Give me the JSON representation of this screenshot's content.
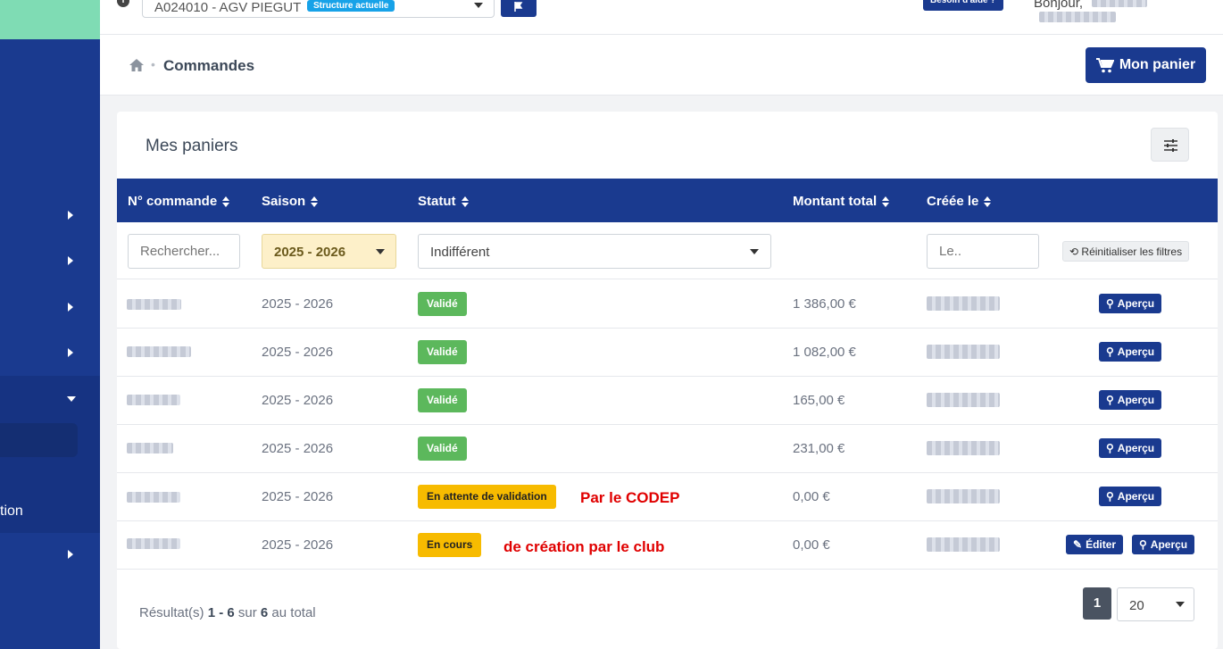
{
  "topbar": {
    "structure": "A024010 - AGV PIEGUT",
    "structure_badge": "Structure actuelle",
    "help": "Besoin d'aide ?",
    "greeting": "Bonjour,"
  },
  "breadcrumb": {
    "title": "Commandes"
  },
  "cart_button": "Mon panier",
  "sidebar": {
    "partial_label": "tion"
  },
  "card": {
    "title": "Mes paniers"
  },
  "table": {
    "headers": [
      "N° commande",
      "Saison",
      "Statut",
      "Montant total",
      "Créée le"
    ],
    "filters": {
      "search_placeholder": "Rechercher...",
      "season": "2025 - 2026",
      "status": "Indifférent",
      "date_placeholder": "Le..",
      "reset": "Réinitialiser les filtres"
    },
    "rows": [
      {
        "season": "2025 - 2026",
        "status": "Validé",
        "amount": "1 386,00 €",
        "action": "Aperçu"
      },
      {
        "season": "2025 - 2026",
        "status": "Validé",
        "amount": "1 082,00 €",
        "action": "Aperçu"
      },
      {
        "season": "2025 - 2026",
        "status": "Validé",
        "amount": "165,00 €",
        "action": "Aperçu"
      },
      {
        "season": "2025 - 2026",
        "status": "Validé",
        "amount": "231,00 €",
        "action": "Aperçu"
      },
      {
        "season": "2025 - 2026",
        "status": "En attente de validation",
        "note": "Par le CODEP",
        "amount": "0,00 €",
        "action": "Aperçu"
      },
      {
        "season": "2025 - 2026",
        "status": "En cours",
        "note": "de création par le club",
        "amount": "0,00 €",
        "edit": "Éditer",
        "action": "Aperçu"
      }
    ]
  },
  "pagination": {
    "prefix": "Résultat(s)",
    "range": "1 - 6",
    "middle": "sur",
    "total": "6",
    "suffix": "au total",
    "page": "1",
    "per_page": "20"
  },
  "colors": {
    "primary": "#1a3a8f",
    "success": "#5cb85c",
    "warning": "#f7bb00",
    "annotation": "#e00000"
  }
}
